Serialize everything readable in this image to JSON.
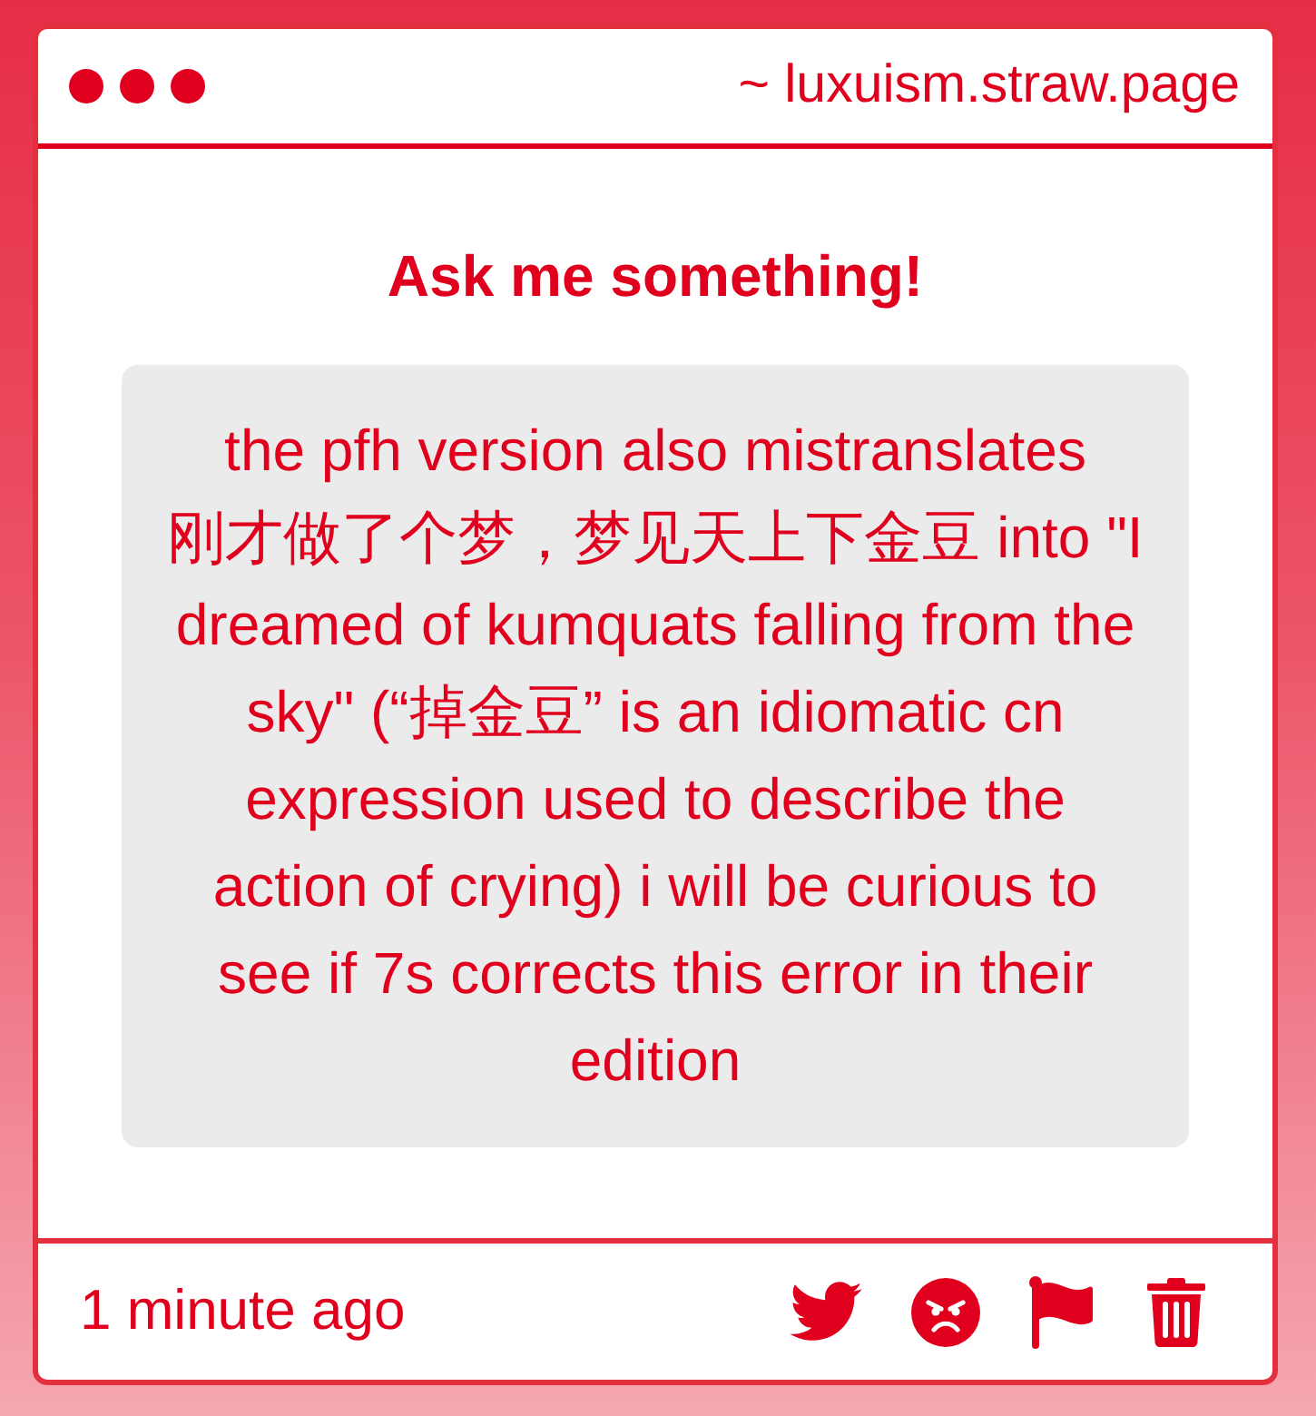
{
  "window": {
    "title": "~ luxuism.straw.page"
  },
  "prompt": {
    "title": "Ask me something!"
  },
  "question": {
    "text": "the pfh version also mistranslates 刚才做了个梦，梦见天上下金豆 into \"I dreamed of kumquats falling from the sky\" (“掉金豆” is an idiomatic cn expression used to describe the action of crying) i will be curious to see if 7s corrects this error in their edition"
  },
  "footer": {
    "time": "1 minute ago"
  }
}
